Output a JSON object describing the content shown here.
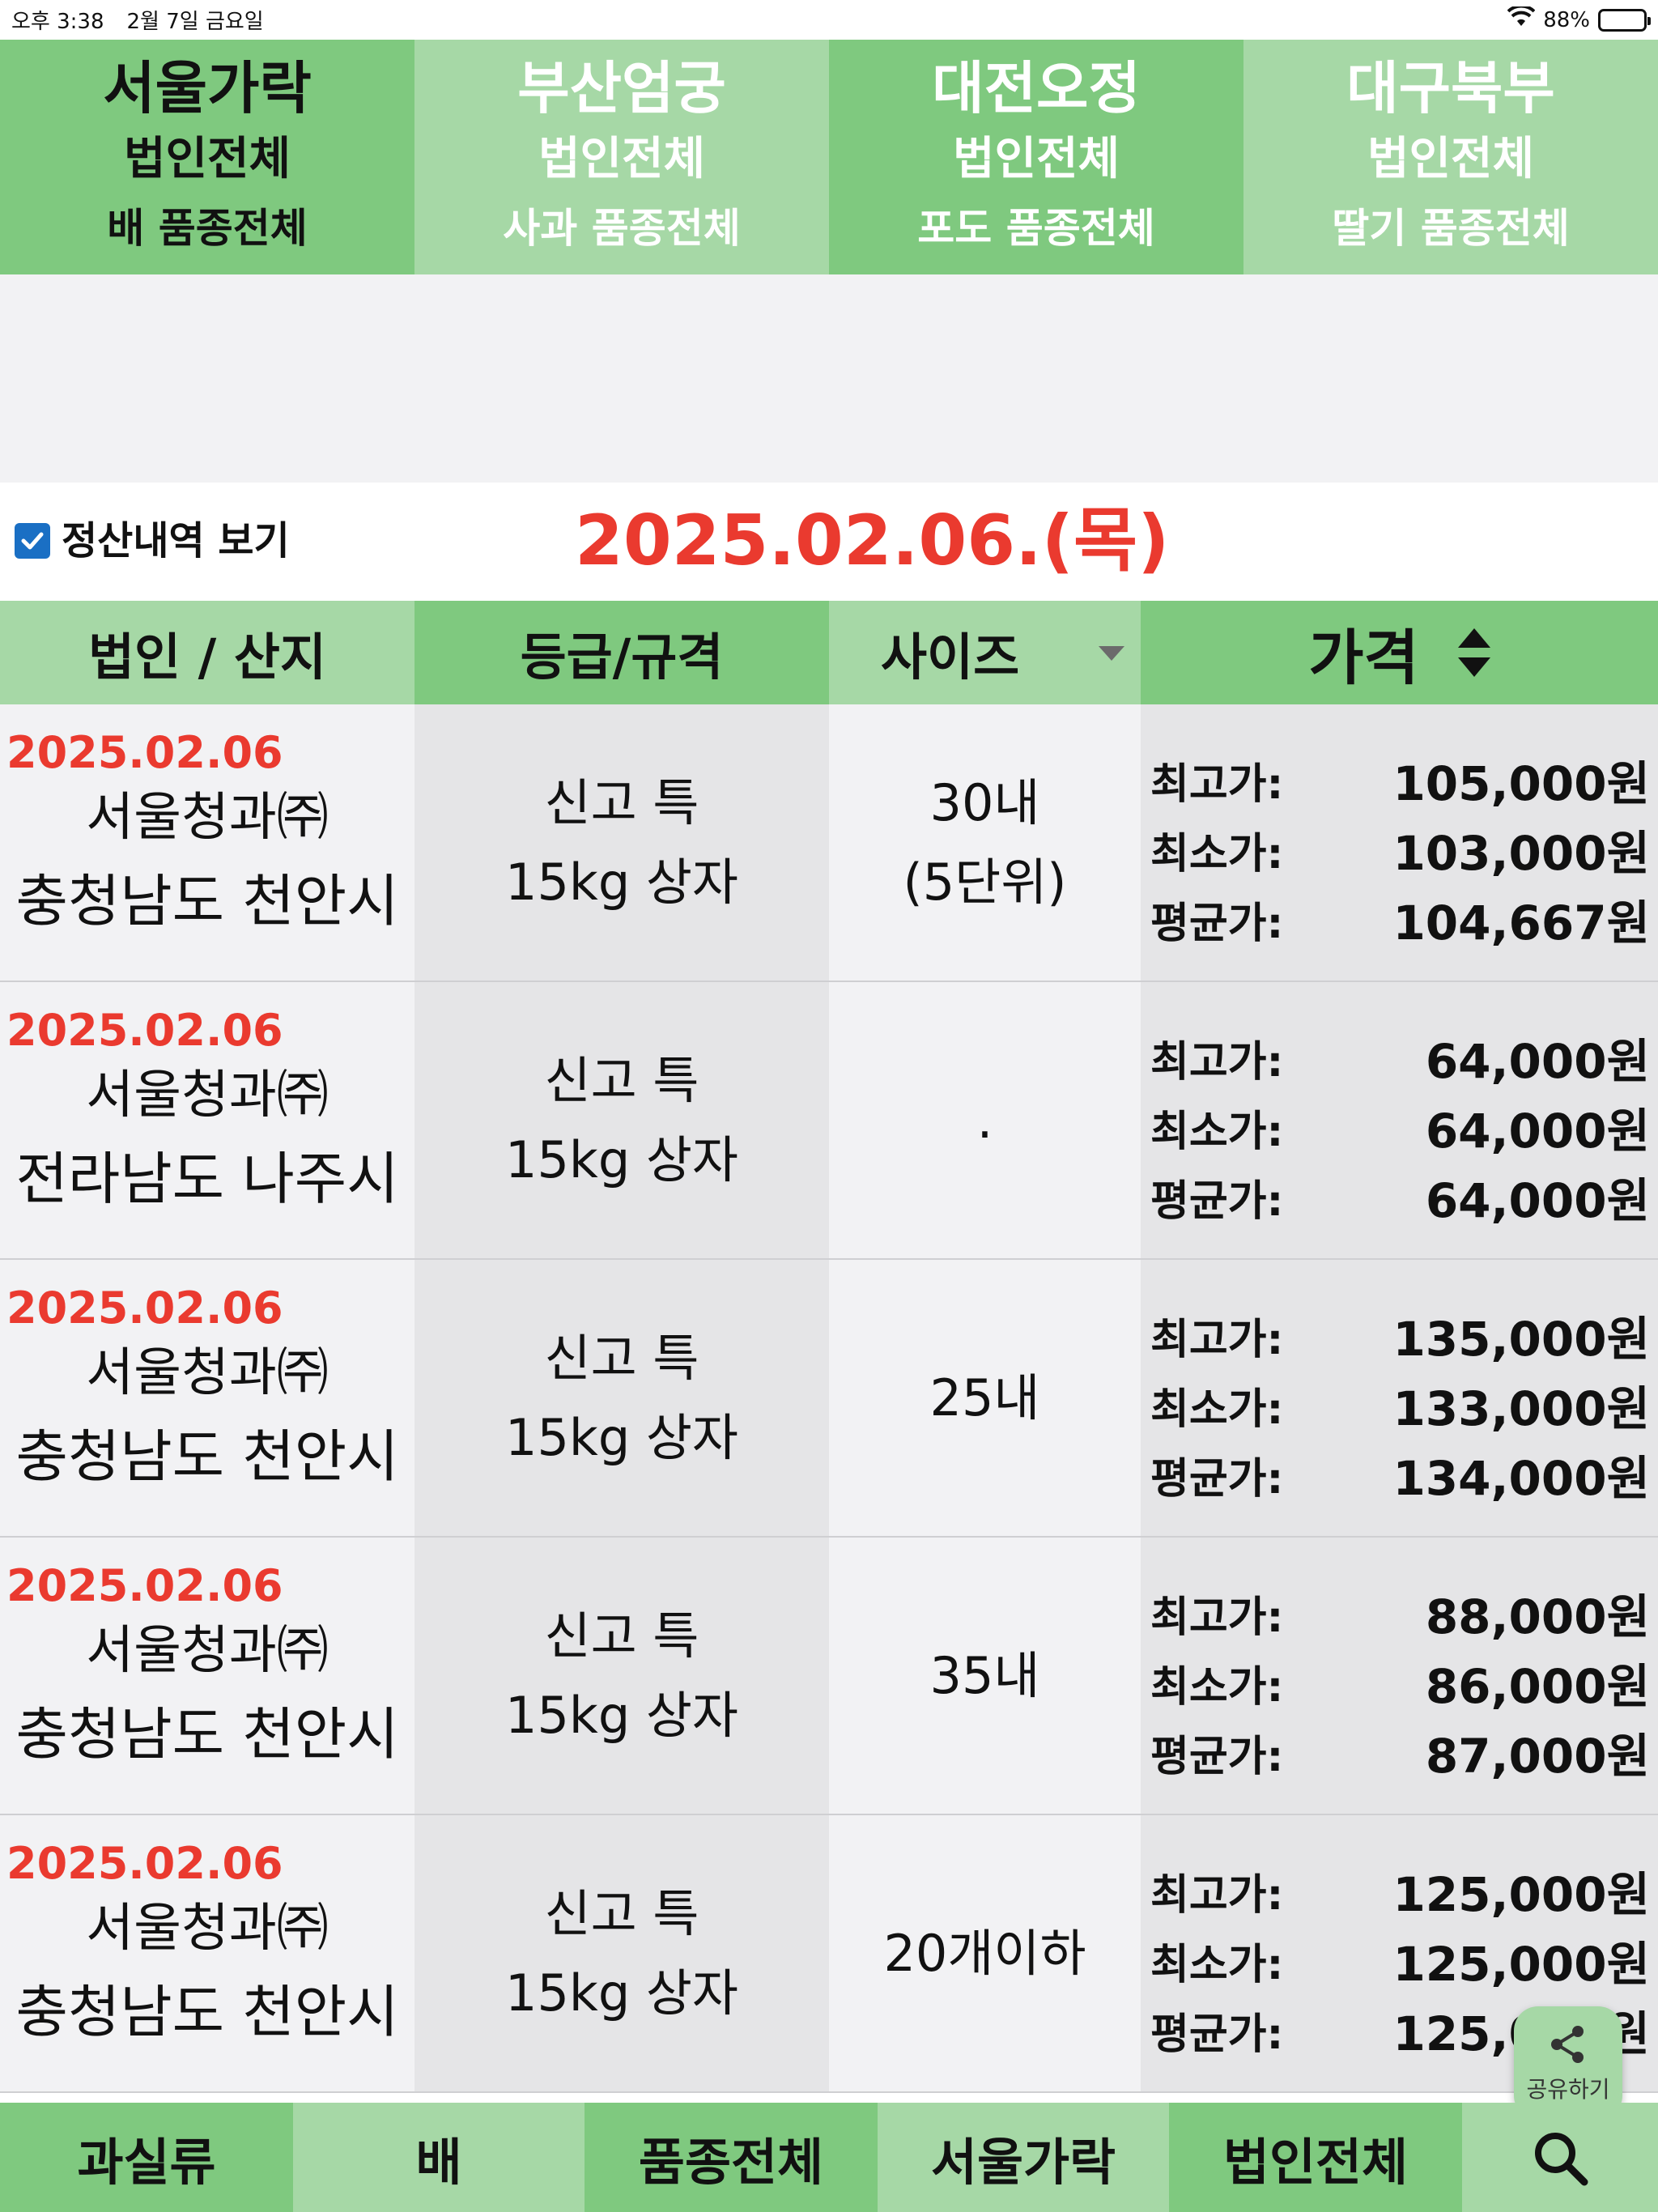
{
  "status_bar": {
    "time": "오후 3:38",
    "date": "2월 7일 금요일",
    "battery": "88%",
    "battery_level": 0.88
  },
  "market_tabs": [
    {
      "market": "서울가락",
      "corp": "법인전체",
      "item": "배 품종전체",
      "selected": true
    },
    {
      "market": "부산엄궁",
      "corp": "법인전체",
      "item": "사과 품종전체",
      "selected": false
    },
    {
      "market": "대전오정",
      "corp": "법인전체",
      "item": "포도 품종전체",
      "selected": false
    },
    {
      "market": "대구북부",
      "corp": "법인전체",
      "item": "딸기 품종전체",
      "selected": false
    }
  ],
  "settle": {
    "checked": true,
    "label": "정산내역 보기",
    "date_title": "2025.02.06.(목)"
  },
  "table": {
    "headers": {
      "corp_origin": "법인 / 산지",
      "grade": "등급/규격",
      "size": "사이즈",
      "price": "가격"
    },
    "price_labels": {
      "max": "최고가:",
      "min": "최소가:",
      "avg": "평균가:"
    },
    "rows": [
      {
        "date": "2025.02.06",
        "corp": "서울청과㈜",
        "origin": "충청남도 천안시",
        "grade": "신고 특",
        "spec": "15kg 상자",
        "size1": "30내",
        "size2": "(5단위)",
        "max": "105,000원",
        "min": "103,000원",
        "avg": "104,667원"
      },
      {
        "date": "2025.02.06",
        "corp": "서울청과㈜",
        "origin": "전라남도 나주시",
        "grade": "신고 특",
        "spec": "15kg 상자",
        "size1": ".",
        "size2": "",
        "max": "64,000원",
        "min": "64,000원",
        "avg": "64,000원"
      },
      {
        "date": "2025.02.06",
        "corp": "서울청과㈜",
        "origin": "충청남도 천안시",
        "grade": "신고 특",
        "spec": "15kg 상자",
        "size1": "25내",
        "size2": "",
        "max": "135,000원",
        "min": "133,000원",
        "avg": "134,000원"
      },
      {
        "date": "2025.02.06",
        "corp": "서울청과㈜",
        "origin": "충청남도 천안시",
        "grade": "신고 특",
        "spec": "15kg 상자",
        "size1": "35내",
        "size2": "",
        "max": "88,000원",
        "min": "86,000원",
        "avg": "87,000원"
      },
      {
        "date": "2025.02.06",
        "corp": "서울청과㈜",
        "origin": "충청남도 천안시",
        "grade": "신고 특",
        "spec": "15kg 상자",
        "size1": "20개이하",
        "size2": "",
        "max": "125,000원",
        "min": "125,000원",
        "avg": "125,000원"
      }
    ]
  },
  "share": {
    "label": "공유하기",
    "icon": "share-icon"
  },
  "bottom_bar": {
    "category": "과실류",
    "item": "배",
    "variety": "품종전체",
    "market": "서울가락",
    "corp": "법인전체",
    "search_icon": "search-icon"
  },
  "colors": {
    "green_dark": "#7fc97f",
    "green_light": "#a6d8a6",
    "accent_red": "#ea3a2f",
    "checkbox_blue": "#1a6fc4"
  }
}
